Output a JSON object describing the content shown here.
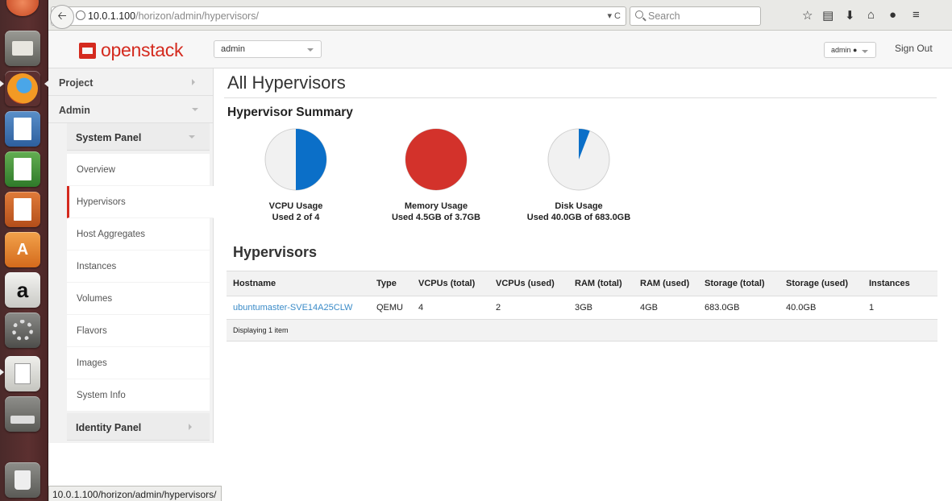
{
  "browser": {
    "url_host": "10.0.1.100",
    "url_path": "/horizon/admin/hypervisors/",
    "search_placeholder": "Search"
  },
  "header": {
    "logo_text": "openstack",
    "project": "admin",
    "user": "admin",
    "sign_out": "Sign Out"
  },
  "sidebar": {
    "project": "Project",
    "admin": "Admin",
    "system_panel": "System Panel",
    "items": [
      "Overview",
      "Hypervisors",
      "Host Aggregates",
      "Instances",
      "Volumes",
      "Flavors",
      "Images",
      "System Info"
    ],
    "active_item": "Hypervisors",
    "identity_panel": "Identity Panel"
  },
  "main": {
    "title": "All Hypervisors",
    "summary_title": "Hypervisor Summary",
    "charts": [
      {
        "label": "VCPU Usage",
        "detail": "Used 2 of 4",
        "fraction": 0.5,
        "color": "#0b6fc8"
      },
      {
        "label": "Memory Usage",
        "detail": "Used 4.5GB of 3.7GB",
        "fraction": 1.0,
        "color": "#d3322b"
      },
      {
        "label": "Disk Usage",
        "detail": "Used 40.0GB of 683.0GB",
        "fraction": 0.0586,
        "color": "#0b6fc8"
      }
    ],
    "table_title": "Hypervisors",
    "table": {
      "columns": [
        "Hostname",
        "Type",
        "VCPUs (total)",
        "VCPUs (used)",
        "RAM (total)",
        "RAM (used)",
        "Storage (total)",
        "Storage (used)",
        "Instances"
      ],
      "rows": [
        [
          "ubuntumaster-SVE14A25CLW",
          "QEMU",
          "4",
          "2",
          "3GB",
          "4GB",
          "683.0GB",
          "40.0GB",
          "1"
        ]
      ],
      "footer": "Displaying 1 item"
    }
  },
  "status_bar": "10.0.1.100/horizon/admin/hypervisors/"
}
